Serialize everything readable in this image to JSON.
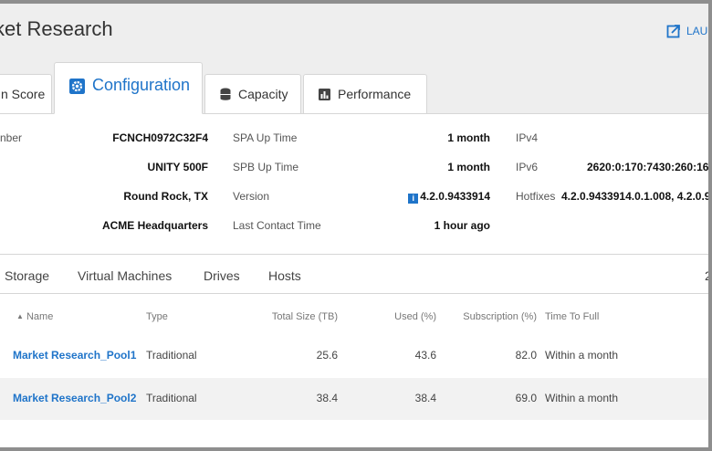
{
  "header": {
    "title": "ket Research",
    "launch_label": "LAUN"
  },
  "tabs": [
    {
      "label": "n Score",
      "icon": "none"
    },
    {
      "label": "Configuration",
      "icon": "gear-icon",
      "active": true
    },
    {
      "label": "Capacity",
      "icon": "database-icon"
    },
    {
      "label": "Performance",
      "icon": "bar-chart-icon"
    }
  ],
  "summary": {
    "col1": [
      {
        "label": "nber",
        "value": "FCNCH0972C32F4"
      },
      {
        "label": "",
        "value": "UNITY 500F"
      },
      {
        "label": "",
        "value": "Round Rock, TX"
      },
      {
        "label": "",
        "value": "ACME Headquarters"
      }
    ],
    "col2": [
      {
        "label": "SPA Up Time",
        "value": "1 month"
      },
      {
        "label": "SPB Up Time",
        "value": "1 month"
      },
      {
        "label": "Version",
        "value": "4.2.0.9433914",
        "info_icon": "i"
      },
      {
        "label": "Last Contact Time",
        "value": "1 hour ago"
      }
    ],
    "col3": [
      {
        "label": "IPv4",
        "value": ""
      },
      {
        "label": "IPv6",
        "value": "2620:0:170:7430:260:160"
      },
      {
        "label": "Hotfixes",
        "value": "4.2.0.9433914.0.1.008, 4.2.0.9"
      }
    ]
  },
  "subtabs": [
    "Storage",
    "Virtual Machines",
    "Drives",
    "Hosts"
  ],
  "subtabs_count": "2",
  "table": {
    "headers": [
      "Name",
      "Type",
      "Total Size (TB)",
      "Used (%)",
      "Subscription (%)",
      "Time To Full"
    ],
    "sort_indicator": "▲",
    "rows": [
      {
        "name": "Market Research_Pool1",
        "type": "Traditional",
        "total": "25.6",
        "used": "43.6",
        "subscription": "82.0",
        "ttf": "Within a month"
      },
      {
        "name": "Market Research_Pool2",
        "type": "Traditional",
        "total": "38.4",
        "used": "38.4",
        "subscription": "69.0",
        "ttf": "Within a month"
      }
    ]
  },
  "colors": {
    "accent": "#1f74c9",
    "header_bg": "#eeeeee",
    "row_alt": "#f2f2f2"
  }
}
